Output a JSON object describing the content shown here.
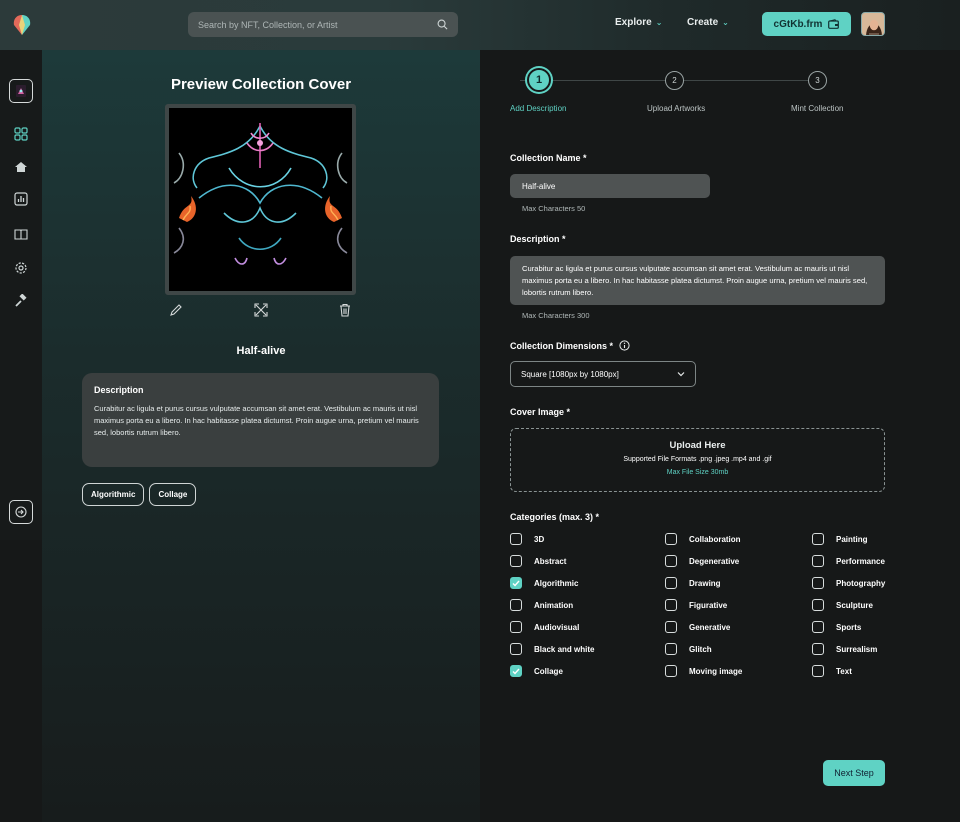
{
  "header": {
    "search_placeholder": "Search by NFT, Collection, or Artist",
    "explore_label": "Explore",
    "create_label": "Create",
    "wallet_label": "cGtKb.frm"
  },
  "sidebar": {
    "icons": [
      "collection-icon",
      "grid-icon",
      "marketplace-icon",
      "stats-icon",
      "book-icon",
      "settings-icon",
      "gavel-icon"
    ],
    "logout_icon": "login-icon"
  },
  "preview": {
    "title": "Preview Collection Cover",
    "collection_name": "Half-alive",
    "description_heading": "Description",
    "description_text": "Curabitur ac ligula et purus cursus vulputate accumsan sit amet erat. Vestibulum ac mauris ut nisl maximus porta eu a libero. In hac habitasse platea dictumst. Proin augue urna, pretium vel mauris sed, lobortis rutrum libero.",
    "tags": [
      "Algorithmic",
      "Collage"
    ]
  },
  "steps": [
    {
      "num": "1",
      "label": "Add Description",
      "active": true
    },
    {
      "num": "2",
      "label": "Upload Artworks",
      "active": false
    },
    {
      "num": "3",
      "label": "Mint Collection",
      "active": false
    }
  ],
  "form": {
    "name_label": "Collection Name *",
    "name_value": "Half-alive",
    "name_hint": "Max Characters 50",
    "desc_label": "Description *",
    "desc_value": "Curabitur ac ligula et purus cursus vulputate accumsan sit amet erat. Vestibulum ac mauris ut nisl maximus porta eu a libero. In hac habitasse platea dictumst. Proin augue urna, pretium vel mauris sed, lobortis rutrum libero.",
    "desc_hint": "Max Characters 300",
    "dims_label": "Collection Dimensions *",
    "dims_value": "Square [1080px by 1080px]",
    "cover_label": "Cover Image *",
    "upload_title": "Upload Here",
    "upload_formats": "Supported File Formats .png .jpeg .mp4 and .gif",
    "upload_max": "Max File Size 30mb",
    "categories_label": "Categories (max. 3) *",
    "next_label": "Next Step"
  },
  "categories": [
    [
      {
        "label": "3D",
        "checked": false
      },
      {
        "label": "Abstract",
        "checked": false
      },
      {
        "label": "Algorithmic",
        "checked": true
      },
      {
        "label": "Animation",
        "checked": false
      },
      {
        "label": "Audiovisual",
        "checked": false
      },
      {
        "label": "Black and white",
        "checked": false
      },
      {
        "label": "Collage",
        "checked": true
      }
    ],
    [
      {
        "label": "Collaboration",
        "checked": false
      },
      {
        "label": "Degenerative",
        "checked": false
      },
      {
        "label": "Drawing",
        "checked": false
      },
      {
        "label": "Figurative",
        "checked": false
      },
      {
        "label": "Generative",
        "checked": false
      },
      {
        "label": "Glitch",
        "checked": false
      },
      {
        "label": "Moving image",
        "checked": false
      }
    ],
    [
      {
        "label": "Painting",
        "checked": false
      },
      {
        "label": "Performance",
        "checked": false
      },
      {
        "label": "Photography",
        "checked": false
      },
      {
        "label": "Sculpture",
        "checked": false
      },
      {
        "label": "Sports",
        "checked": false
      },
      {
        "label": "Surrealism",
        "checked": false
      },
      {
        "label": "Text",
        "checked": false
      }
    ]
  ],
  "colors": {
    "accent": "#5fd2c4",
    "panel": "#3a3f3f",
    "field": "#4f5353"
  }
}
